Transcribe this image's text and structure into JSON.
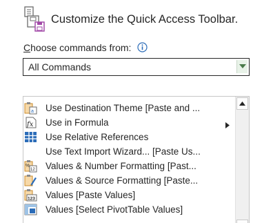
{
  "header": {
    "title": "Customize the Quick Access Toolbar.",
    "icon": "customize-toolbar-icon"
  },
  "choose": {
    "label_underlined": "C",
    "label_rest": "hoose commands from:",
    "info_icon": "info-icon"
  },
  "dropdown": {
    "value": "All Commands",
    "arrow_icon": "triangle-down-icon"
  },
  "commands": {
    "items": [
      {
        "label": "Use Destination Theme [Paste and ...",
        "icon": "paste-destination-theme-icon",
        "has_submenu": false
      },
      {
        "label": "Use in Formula",
        "icon": "use-in-formula-icon",
        "has_submenu": true
      },
      {
        "label": "Use Relative References",
        "icon": "relative-references-icon",
        "has_submenu": false
      },
      {
        "label": "Use Text Import Wizard... [Paste Us...",
        "icon": "",
        "has_submenu": false
      },
      {
        "label": "Values & Number Formatting [Past...",
        "icon": "paste-values-number-formatting-icon",
        "has_submenu": false
      },
      {
        "label": "Values & Source Formatting [Paste...",
        "icon": "paste-values-source-formatting-icon",
        "has_submenu": false
      },
      {
        "label": "Values [Paste Values]",
        "icon": "paste-values-icon",
        "has_submenu": false
      },
      {
        "label": "Values [Select PivotTable Values]",
        "icon": "select-pivottable-values-icon",
        "has_submenu": false
      }
    ]
  },
  "colors": {
    "text": "#262626",
    "icon_orange": "#e8a03a",
    "icon_blue": "#2b6cb8",
    "icon_purple": "#a24aa8",
    "dropdown_button_bg": "#e8f2e8"
  }
}
